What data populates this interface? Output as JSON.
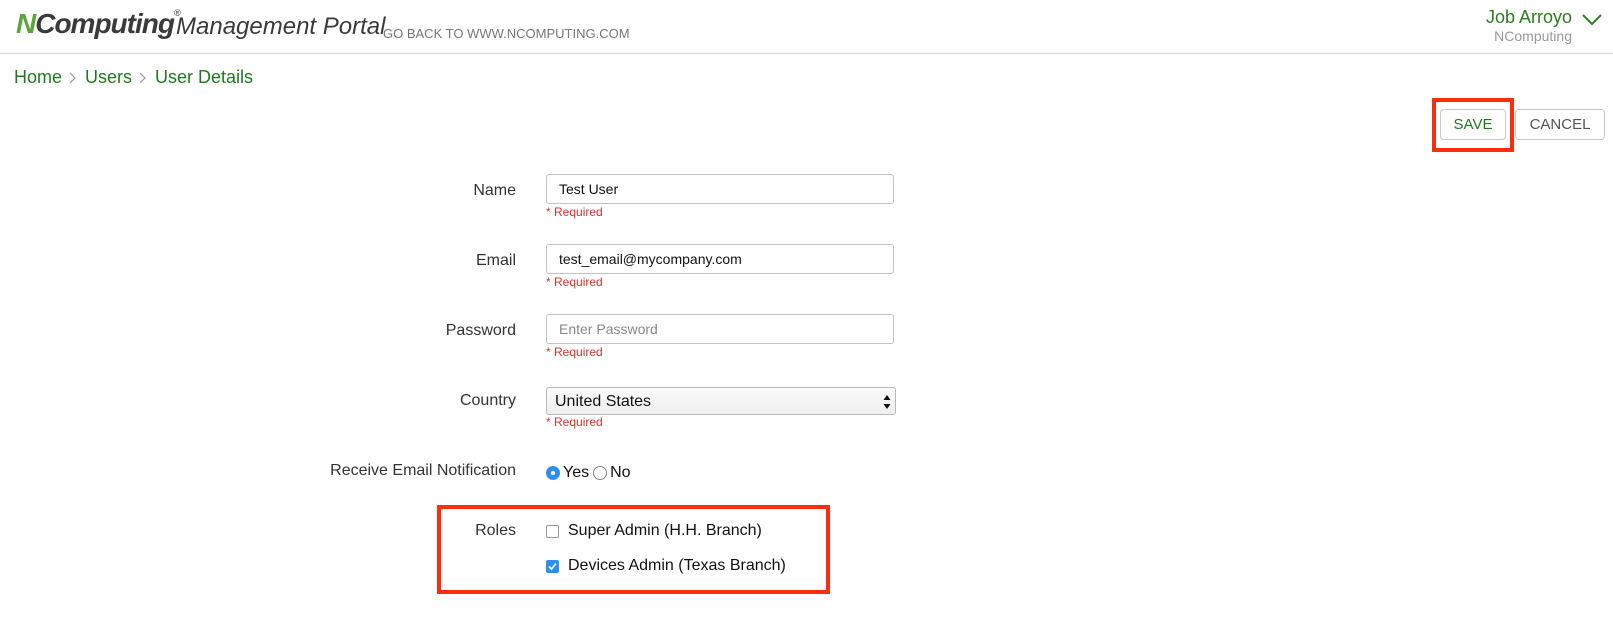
{
  "header": {
    "logo_n": "N",
    "logo_rest": "Computing",
    "logo_tm": "®",
    "portal_title": "Management Portal",
    "goback_link": "GO BACK TO WWW.NCOMPUTING.COM",
    "user_name": "Job Arroyo",
    "user_org": "NComputing",
    "chevron_icon": "chevron-down-icon"
  },
  "breadcrumb": {
    "items": [
      "Home",
      "Users",
      "User Details"
    ],
    "separator_icon": "chevron-right-icon"
  },
  "toolbar": {
    "save_label": "SAVE",
    "cancel_label": "CANCEL"
  },
  "form": {
    "name": {
      "label": "Name",
      "value": "Test User",
      "required": "* Required"
    },
    "email": {
      "label": "Email",
      "value": "test_email@mycompany.com",
      "required": "* Required"
    },
    "password": {
      "label": "Password",
      "placeholder": "Enter Password",
      "value": "",
      "required": "* Required"
    },
    "country": {
      "label": "Country",
      "selected": "United States",
      "required": "* Required"
    },
    "notification": {
      "label": "Receive Email Notification",
      "options": [
        "Yes",
        "No"
      ],
      "selected": "Yes"
    },
    "roles": {
      "label": "Roles",
      "items": [
        {
          "label": "Super Admin (H.H. Branch)",
          "checked": false
        },
        {
          "label": "Devices Admin (Texas Branch)",
          "checked": true
        }
      ]
    }
  },
  "colors": {
    "brand_green": "#2e7d1e",
    "link_green": "#1f7a1f",
    "required_red": "#d9322b",
    "highlight_red": "#ff2d0a",
    "control_blue": "#2f8ff0"
  }
}
